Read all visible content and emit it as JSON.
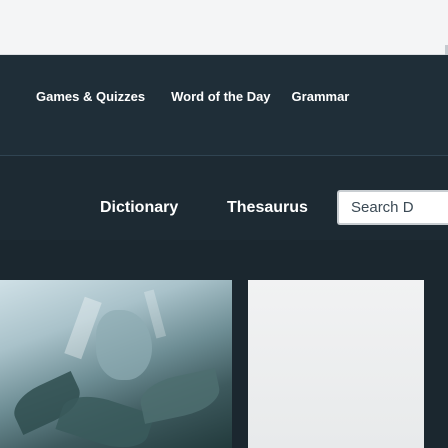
{
  "nav": {
    "items": [
      {
        "label": "Games & Quizzes"
      },
      {
        "label": "Word of the Day"
      },
      {
        "label": "Grammar"
      }
    ]
  },
  "search": {
    "tabs": [
      {
        "label": "Dictionary"
      },
      {
        "label": "Thesaurus"
      }
    ],
    "placeholder": "Search D"
  },
  "colors": {
    "nav_background": "#1f2e38",
    "text": "#ffffff",
    "top_strip": "#f4f5f6"
  }
}
